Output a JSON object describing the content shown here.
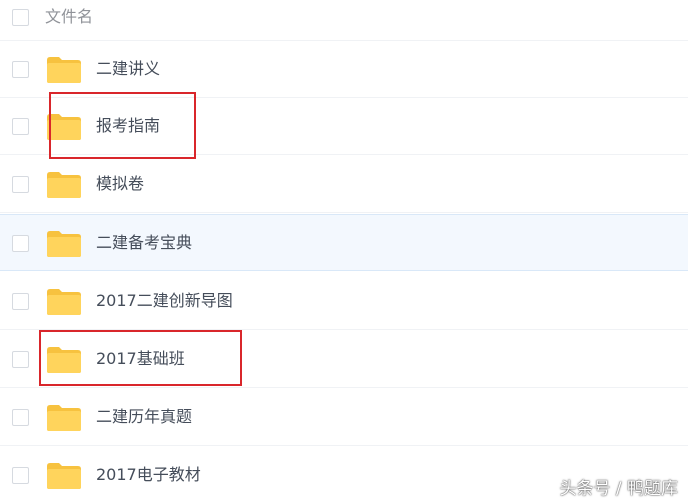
{
  "header": {
    "column_label": "文件名"
  },
  "rows": [
    {
      "name": "二建讲义"
    },
    {
      "name": "报考指南"
    },
    {
      "name": "模拟卷"
    },
    {
      "name": "二建备考宝典"
    },
    {
      "name": "2017二建创新导图"
    },
    {
      "name": "2017基础班"
    },
    {
      "name": "二建历年真题"
    },
    {
      "name": "2017电子教材"
    }
  ],
  "icons": {
    "folder": "folder-icon",
    "checkbox": "checkbox"
  },
  "colors": {
    "folder": "#ffd45c",
    "folder_tab": "#f7c23f",
    "highlight_row": "#f3f8fe",
    "annotation_box": "#d9262b"
  },
  "watermark": "头条号 / 鸭题库"
}
